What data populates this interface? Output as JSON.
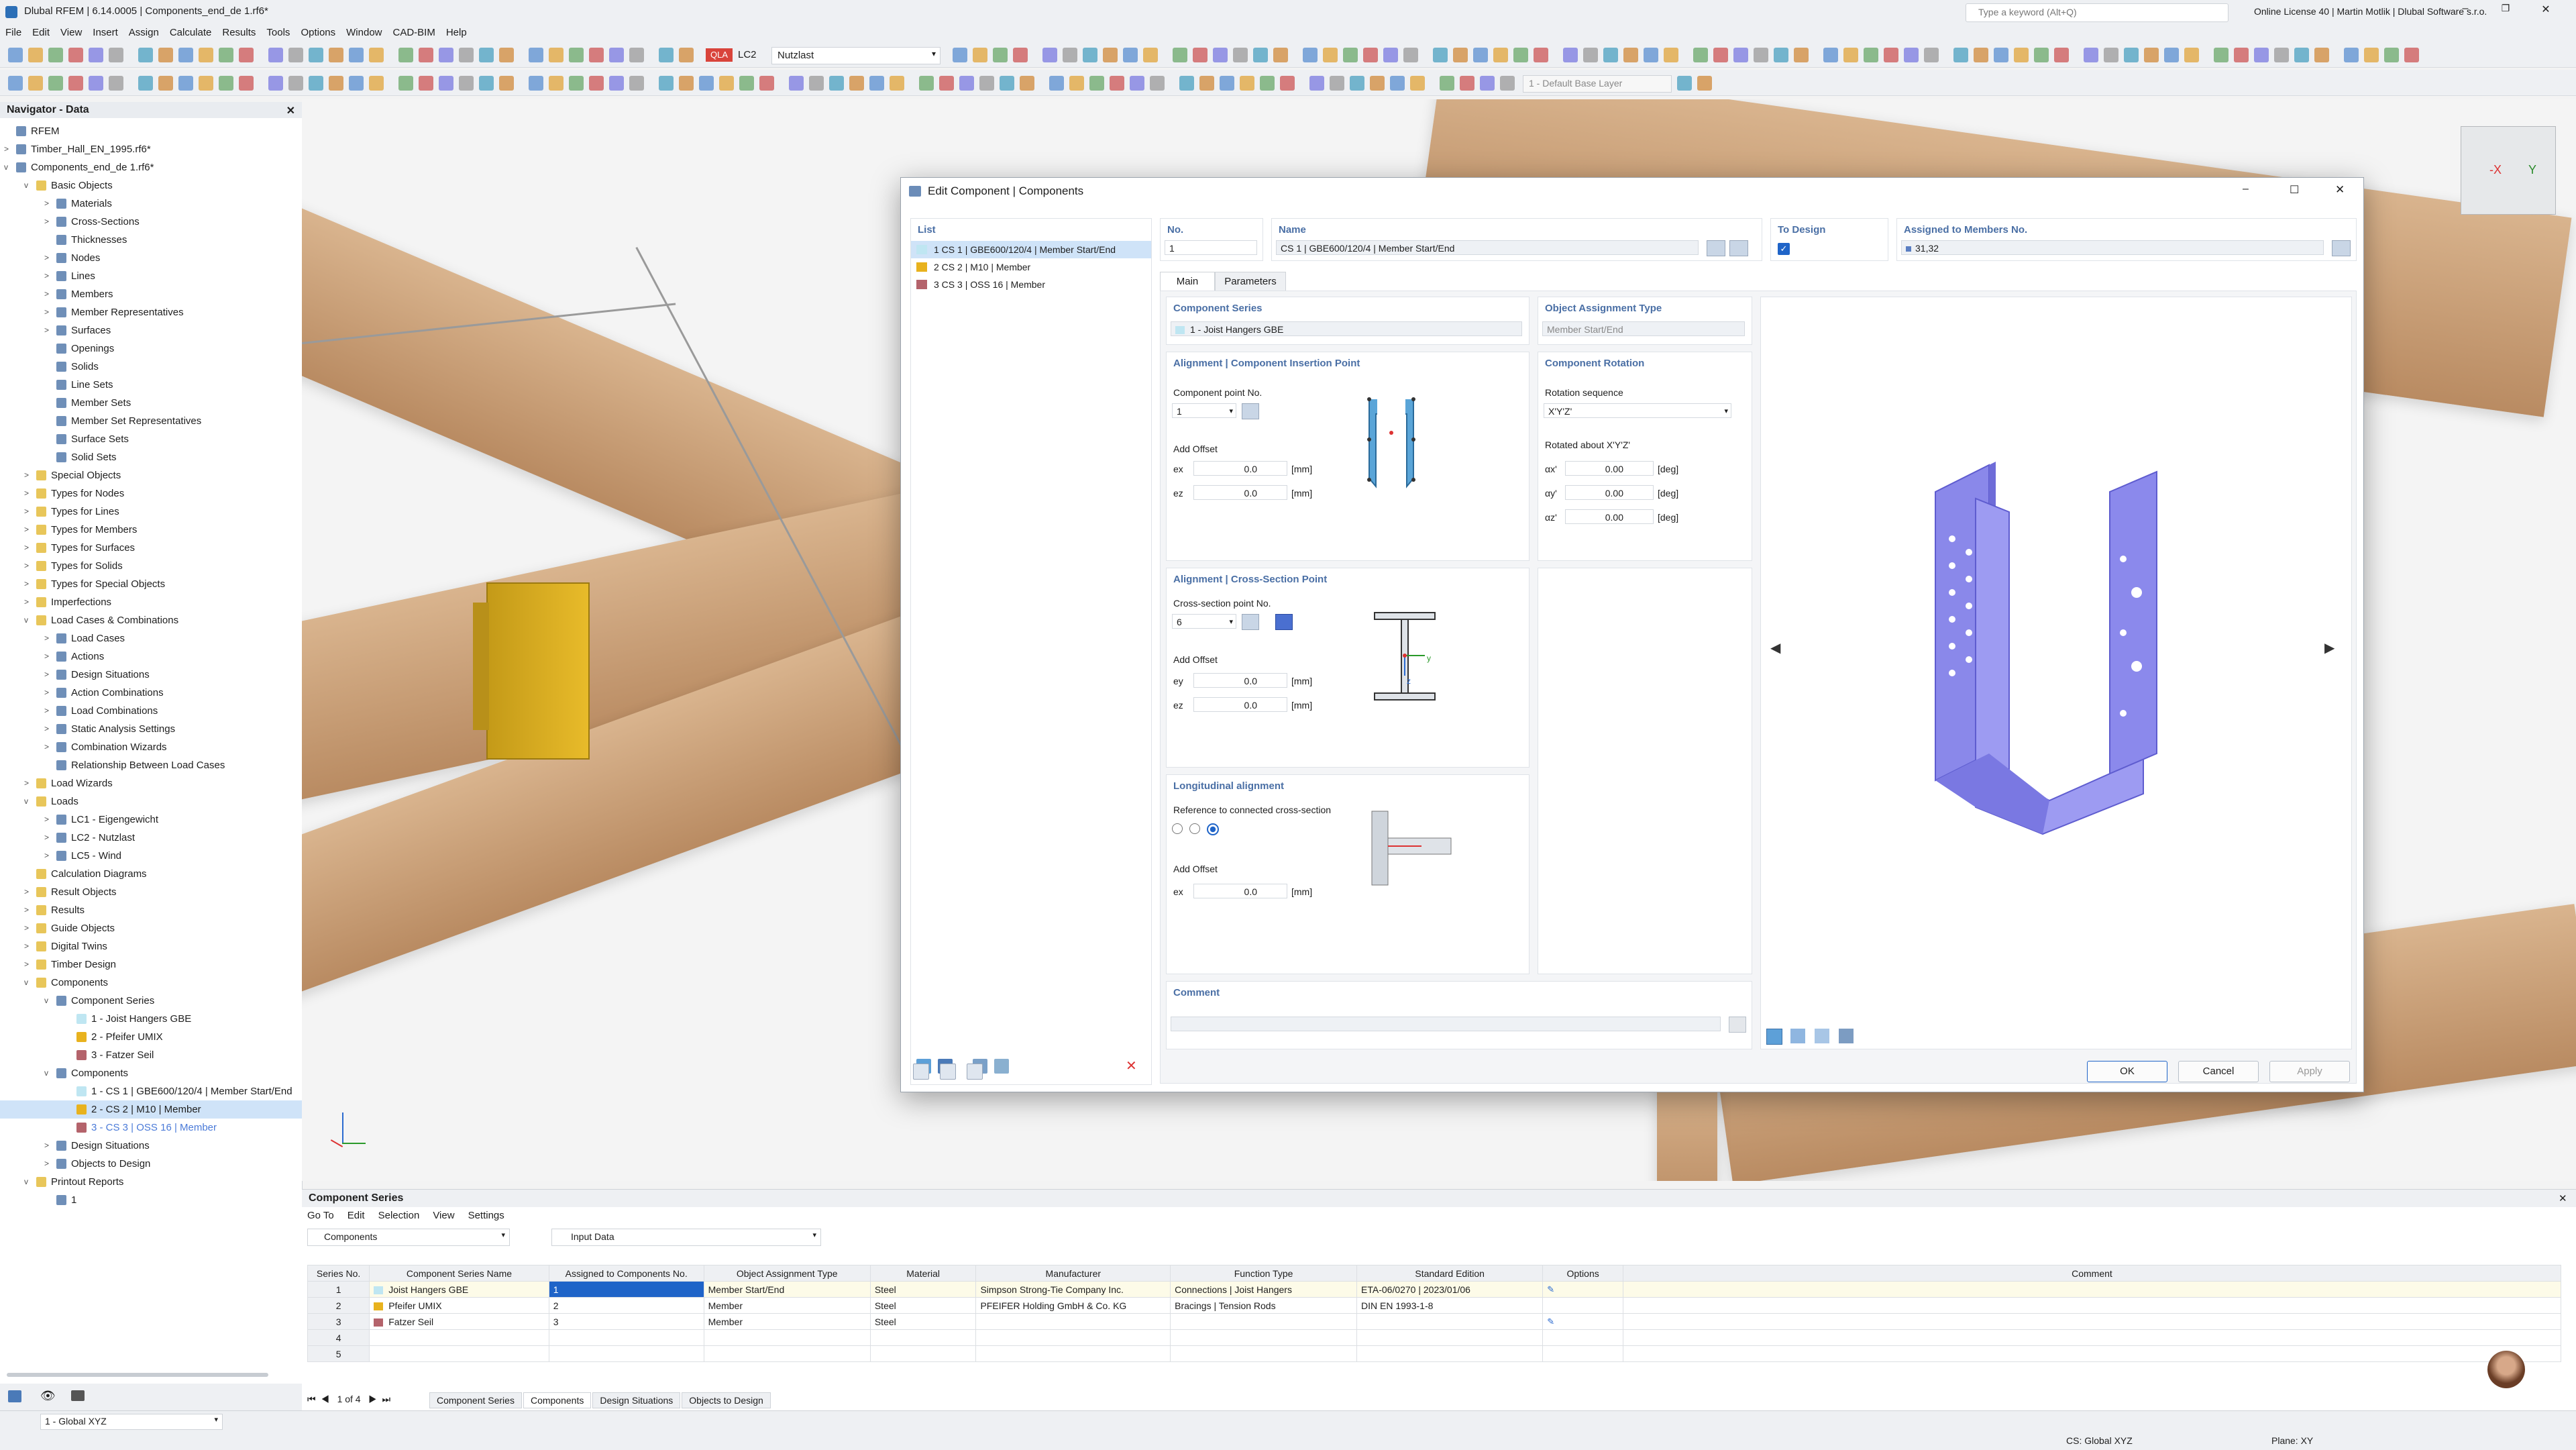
{
  "app": {
    "title": "Dlubal RFEM | 6.14.0005 | Components_end_de 1.rf6*",
    "search_placeholder": "Type a keyword (Alt+Q)",
    "license": "Online License 40 | Martin Motlik | Dlubal Software s.r.o.",
    "lc_code": "LC2",
    "lc_name": "Nutzlast",
    "base_layer": "1 - Default Base Layer"
  },
  "menu": [
    "File",
    "Edit",
    "View",
    "Insert",
    "Assign",
    "Calculate",
    "Results",
    "Tools",
    "Options",
    "Window",
    "CAD-BIM",
    "Help"
  ],
  "navigator": {
    "title": "Navigator - Data",
    "items": [
      {
        "label": "RFEM",
        "level": 0,
        "expand": ""
      },
      {
        "label": "Timber_Hall_EN_1995.rf6*",
        "level": 0,
        "expand": ">"
      },
      {
        "label": "Components_end_de 1.rf6*",
        "level": 0,
        "expand": "v"
      },
      {
        "label": "Basic Objects",
        "level": 1,
        "expand": "v"
      },
      {
        "label": "Materials",
        "level": 2,
        "expand": ">"
      },
      {
        "label": "Cross-Sections",
        "level": 2,
        "expand": ">"
      },
      {
        "label": "Thicknesses",
        "level": 2,
        "expand": ""
      },
      {
        "label": "Nodes",
        "level": 2,
        "expand": ">"
      },
      {
        "label": "Lines",
        "level": 2,
        "expand": ">"
      },
      {
        "label": "Members",
        "level": 2,
        "expand": ">"
      },
      {
        "label": "Member Representatives",
        "level": 2,
        "expand": ">"
      },
      {
        "label": "Surfaces",
        "level": 2,
        "expand": ">"
      },
      {
        "label": "Openings",
        "level": 2,
        "expand": ""
      },
      {
        "label": "Solids",
        "level": 2,
        "expand": ""
      },
      {
        "label": "Line Sets",
        "level": 2,
        "expand": ""
      },
      {
        "label": "Member Sets",
        "level": 2,
        "expand": ""
      },
      {
        "label": "Member Set Representatives",
        "level": 2,
        "expand": ""
      },
      {
        "label": "Surface Sets",
        "level": 2,
        "expand": ""
      },
      {
        "label": "Solid Sets",
        "level": 2,
        "expand": ""
      },
      {
        "label": "Special Objects",
        "level": 1,
        "expand": ">"
      },
      {
        "label": "Types for Nodes",
        "level": 1,
        "expand": ">"
      },
      {
        "label": "Types for Lines",
        "level": 1,
        "expand": ">"
      },
      {
        "label": "Types for Members",
        "level": 1,
        "expand": ">"
      },
      {
        "label": "Types for Surfaces",
        "level": 1,
        "expand": ">"
      },
      {
        "label": "Types for Solids",
        "level": 1,
        "expand": ">"
      },
      {
        "label": "Types for Special Objects",
        "level": 1,
        "expand": ">"
      },
      {
        "label": "Imperfections",
        "level": 1,
        "expand": ">"
      },
      {
        "label": "Load Cases & Combinations",
        "level": 1,
        "expand": "v"
      },
      {
        "label": "Load Cases",
        "level": 2,
        "expand": ">"
      },
      {
        "label": "Actions",
        "level": 2,
        "expand": ">"
      },
      {
        "label": "Design Situations",
        "level": 2,
        "expand": ">"
      },
      {
        "label": "Action Combinations",
        "level": 2,
        "expand": ">"
      },
      {
        "label": "Load Combinations",
        "level": 2,
        "expand": ">"
      },
      {
        "label": "Static Analysis Settings",
        "level": 2,
        "expand": ">"
      },
      {
        "label": "Combination Wizards",
        "level": 2,
        "expand": ">"
      },
      {
        "label": "Relationship Between Load Cases",
        "level": 2,
        "expand": ""
      },
      {
        "label": "Load Wizards",
        "level": 1,
        "expand": ">"
      },
      {
        "label": "Loads",
        "level": 1,
        "expand": "v"
      },
      {
        "label": "LC1 - Eigengewicht",
        "level": 2,
        "expand": ">"
      },
      {
        "label": "LC2 - Nutzlast",
        "level": 2,
        "expand": ">"
      },
      {
        "label": "LC5 - Wind",
        "level": 2,
        "expand": ">"
      },
      {
        "label": "Calculation Diagrams",
        "level": 1,
        "expand": ""
      },
      {
        "label": "Result Objects",
        "level": 1,
        "expand": ">"
      },
      {
        "label": "Results",
        "level": 1,
        "expand": ">"
      },
      {
        "label": "Guide Objects",
        "level": 1,
        "expand": ">"
      },
      {
        "label": "Digital Twins",
        "level": 1,
        "expand": ">"
      },
      {
        "label": "Timber Design",
        "level": 1,
        "expand": ">"
      },
      {
        "label": "Components",
        "level": 1,
        "expand": "v"
      },
      {
        "label": "Component Series",
        "level": 2,
        "expand": "v"
      },
      {
        "label": "1 - Joist Hangers GBE",
        "level": 3,
        "expand": ""
      },
      {
        "label": "2 - Pfeifer UMIX",
        "level": 3,
        "expand": ""
      },
      {
        "label": "3 - Fatzer Seil",
        "level": 3,
        "expand": ""
      },
      {
        "label": "Components",
        "level": 2,
        "expand": "v"
      },
      {
        "label": "1 - CS 1 | GBE600/120/4 | Member Start/End",
        "level": 3,
        "expand": ""
      },
      {
        "label": "2 - CS 2 | M10 | Member",
        "level": 3,
        "expand": ""
      },
      {
        "label": "3 - CS 3 | OSS 16 | Member",
        "level": 3,
        "expand": ""
      },
      {
        "label": "Design Situations",
        "level": 2,
        "expand": ">"
      },
      {
        "label": "Objects to Design",
        "level": 2,
        "expand": ">"
      },
      {
        "label": "Printout Reports",
        "level": 1,
        "expand": "v"
      },
      {
        "label": "1",
        "level": 2,
        "expand": ""
      }
    ]
  },
  "dialog": {
    "title": "Edit Component | Components",
    "list_header": "List",
    "list": [
      {
        "label": "1  CS 1 | GBE600/120/4 | Member Start/End",
        "color": "#bfe6f2"
      },
      {
        "label": "2  CS 2 | M10 | Member",
        "color": "#e8b21e"
      },
      {
        "label": "3  CS 3 | OSS 16 | Member",
        "color": "#b4636b"
      }
    ],
    "no_label": "No.",
    "no_value": "1",
    "name_label": "Name",
    "name_value": "CS 1 | GBE600/120/4 | Member Start/End",
    "to_design_label": "To Design",
    "assigned_label": "Assigned to Members No.",
    "assigned_value": "31,32",
    "tabs": [
      "Main",
      "Parameters"
    ],
    "series_title": "Component Series",
    "series_value": "1 - Joist Hangers GBE",
    "assign_type_title": "Object Assignment Type",
    "assign_type_value": "Member Start/End",
    "insertion_title": "Alignment | Component Insertion Point",
    "comp_point_label": "Component point No.",
    "comp_point_value": "1",
    "add_offset": "Add Offset",
    "ex_label": "ex",
    "ex_value": "0.0",
    "ez_label": "ez",
    "ez_value": "0.0",
    "unit_mm": "[mm]",
    "rotation_title": "Component Rotation",
    "rot_seq_label": "Rotation sequence",
    "rot_seq_value": "X'Y'Z'",
    "rotated_label": "Rotated about X'Y'Z'",
    "ax_label": "αx'",
    "ax_value": "0.00",
    "ay_label": "αy'",
    "ay_value": "0.00",
    "az_label": "αz'",
    "az_value": "0.00",
    "unit_deg": "[deg]",
    "cs_point_title": "Alignment | Cross-Section Point",
    "cs_point_label": "Cross-section point No.",
    "cs_point_value": "6",
    "ey_label": "ey",
    "ey_value": "0.0",
    "ez2_label": "ez",
    "ez2_value": "0.0",
    "long_title": "Longitudinal alignment",
    "long_ref": "Reference to connected cross-section",
    "ex2_label": "ex",
    "ex2_value": "0.0",
    "comment_title": "Comment",
    "ok": "OK",
    "cancel": "Cancel",
    "apply": "Apply"
  },
  "bottom": {
    "title": "Component Series",
    "menu": [
      "Go To",
      "Edit",
      "Selection",
      "View",
      "Settings"
    ],
    "combo1": "Components",
    "combo2": "Input Data",
    "headers": [
      "Series No.",
      "Component Series Name",
      "Assigned to Components No.",
      "Object Assignment Type",
      "Material",
      "Manufacturer",
      "Function Type",
      "Standard Edition",
      "Options",
      "Comment"
    ],
    "rows": [
      {
        "no": "1",
        "name": "Joist Hangers GBE",
        "color": "#bfe6f2",
        "assigned": "1",
        "type": "Member Start/End",
        "material": "Steel",
        "manufacturer": "Simpson Strong-Tie Company Inc.",
        "function": "Connections | Joist Hangers",
        "standard": "ETA-06/0270 | 2023/01/06"
      },
      {
        "no": "2",
        "name": "Pfeifer UMIX",
        "color": "#e8b21e",
        "assigned": "2",
        "type": "Member",
        "material": "Steel",
        "manufacturer": "PFEIFER Holding GmbH & Co. KG",
        "function": "Bracings | Tension Rods",
        "standard": "DIN EN 1993-1-8"
      },
      {
        "no": "3",
        "name": "Fatzer Seil",
        "color": "#b4636b",
        "assigned": "3",
        "type": "Member",
        "material": "Steel",
        "manufacturer": "",
        "function": "",
        "standard": ""
      },
      {
        "no": "4",
        "name": "",
        "color": "",
        "assigned": "",
        "type": "",
        "material": "",
        "manufacturer": "",
        "function": "",
        "standard": ""
      },
      {
        "no": "5",
        "name": "",
        "color": "",
        "assigned": "",
        "type": "",
        "material": "",
        "manufacturer": "",
        "function": "",
        "standard": ""
      }
    ],
    "pager": "1 of 4",
    "tabs": [
      "Component Series",
      "Components",
      "Design Situations",
      "Objects to Design"
    ]
  },
  "status": {
    "cs": "1 - Global XYZ",
    "cs_global": "CS: Global XYZ",
    "plane": "Plane: XY"
  }
}
